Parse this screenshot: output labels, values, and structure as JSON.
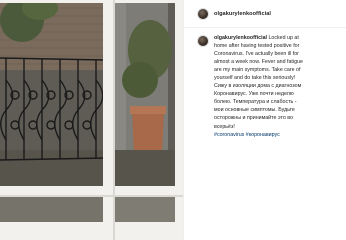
{
  "post": {
    "username": "olgakurylenkoofficial",
    "caption_lines": [
      "Locked up at",
      "home after having tested positive for",
      "Coronavirus. I've actually been ill for",
      "almost a week now. Fever and fatigue",
      "are my main symptoms. Take care of",
      "yourself and do take this seriously!",
      "Сижу в изоляции дома с диагнозом",
      "Коронавирус. Уже почти неделю",
      "болею. Температура и слабость -",
      "мои основные симптомы. Будьте",
      "осторожны и принимайте это во",
      "всерьёз!"
    ],
    "hashtags": "#coronavirus #коронавирус"
  },
  "image": {
    "subject": "view through a white-framed window onto a patio with ornate black iron railing, brick wall and terracotta planter"
  },
  "colors": {
    "username": "#262626",
    "hashtag": "#00376b",
    "divider": "#efefef"
  }
}
